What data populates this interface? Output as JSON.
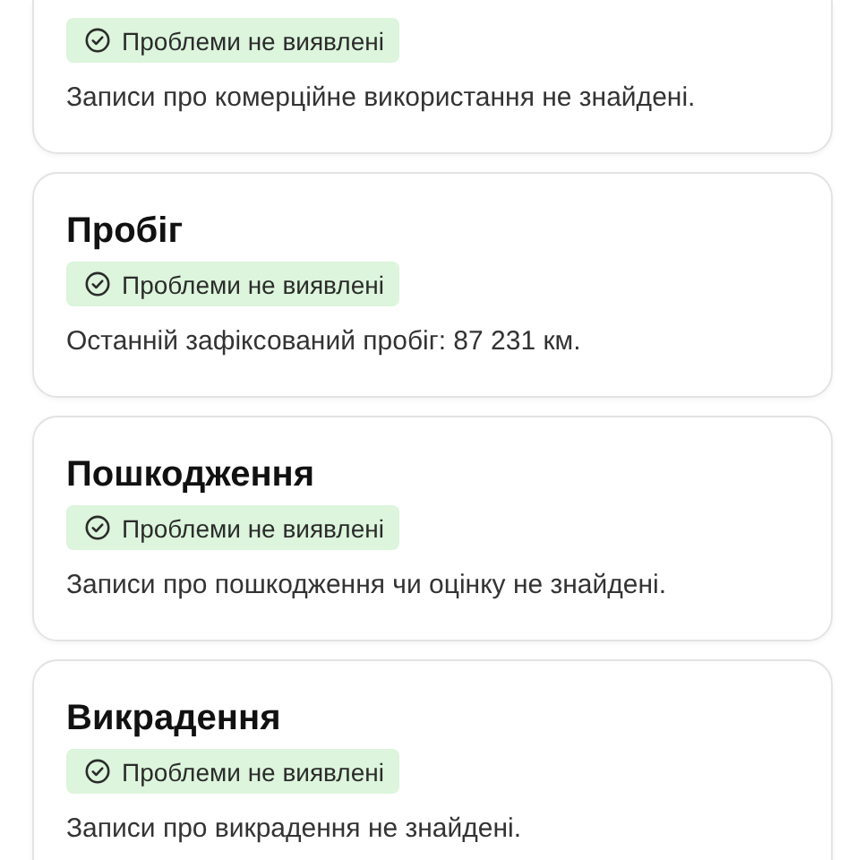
{
  "cards": [
    {
      "badge": {
        "label": "Проблеми не виявлені",
        "ok": true
      },
      "text": "Записи про комерційне використання не знайдені."
    },
    {
      "title": "Пробіг",
      "badge": {
        "label": "Проблеми не виявлені",
        "ok": true
      },
      "text": "Останній зафіксований пробіг: 87 231 км."
    },
    {
      "title": "Пошкодження",
      "badge": {
        "label": "Проблеми не виявлені",
        "ok": true
      },
      "text": "Записи про пошкодження чи оцінку не знайдені."
    },
    {
      "title": "Викрадення",
      "badge": {
        "label": "Проблеми не виявлені",
        "ok": true
      },
      "text": "Записи про викрадення не знайдені."
    }
  ]
}
